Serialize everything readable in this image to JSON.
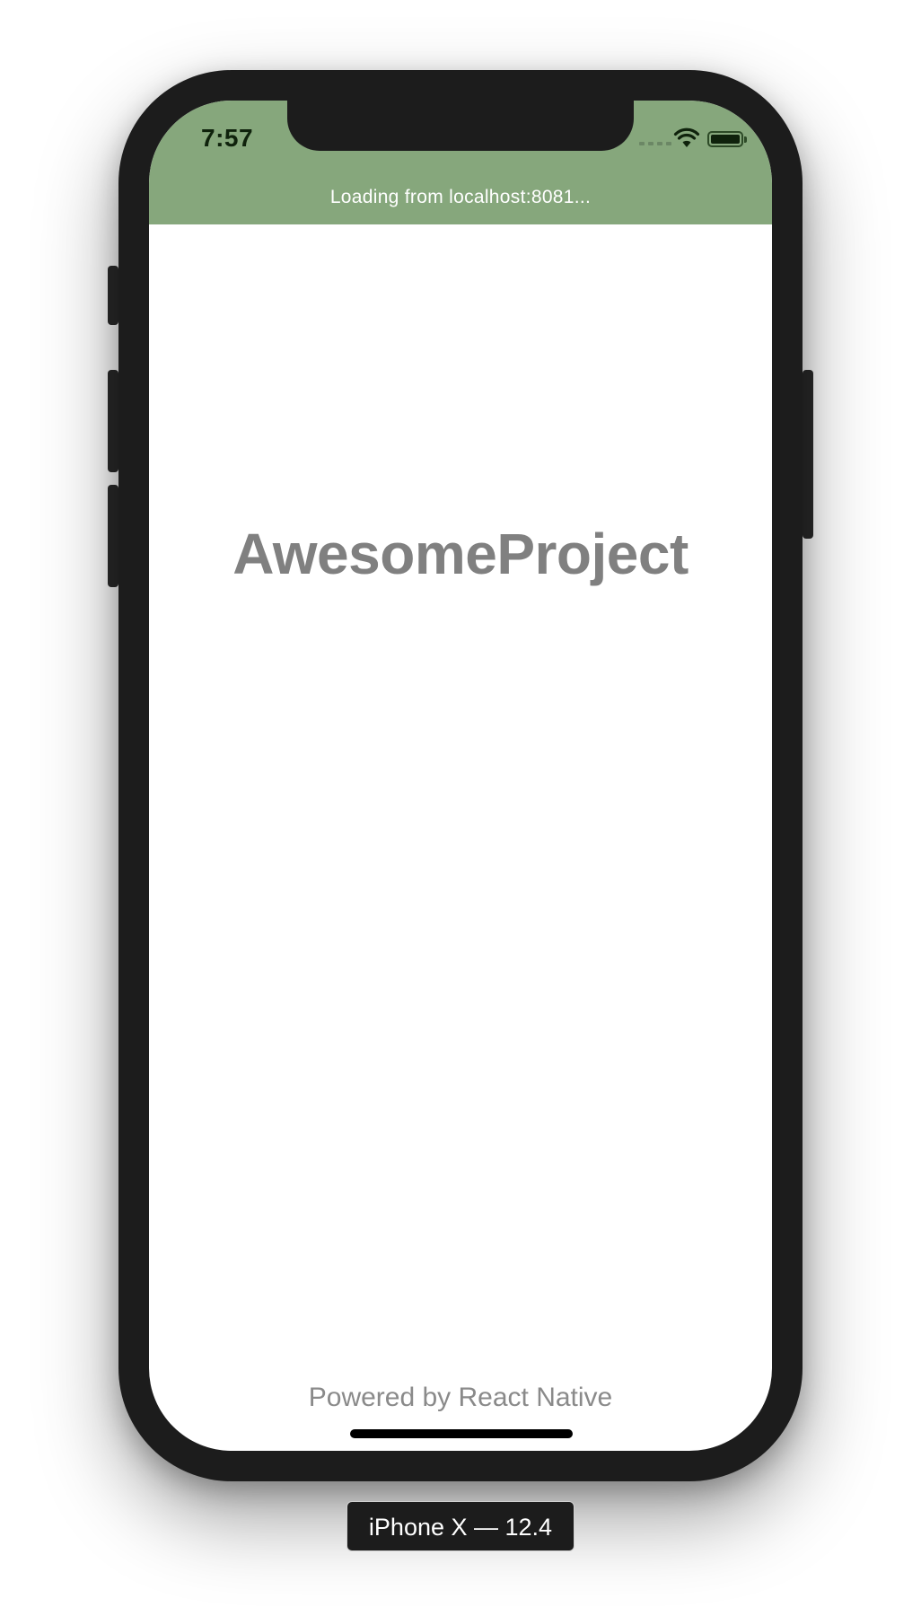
{
  "status_bar": {
    "time": "7:57",
    "background_color": "#86a77c",
    "icons": [
      "cellular-signal-icon",
      "wifi-icon",
      "battery-icon"
    ]
  },
  "banner": {
    "text": "Loading from localhost:8081..."
  },
  "app": {
    "title": "AwesomeProject",
    "footer": "Powered by React Native"
  },
  "simulator": {
    "device_label": "iPhone X — 12.4"
  }
}
